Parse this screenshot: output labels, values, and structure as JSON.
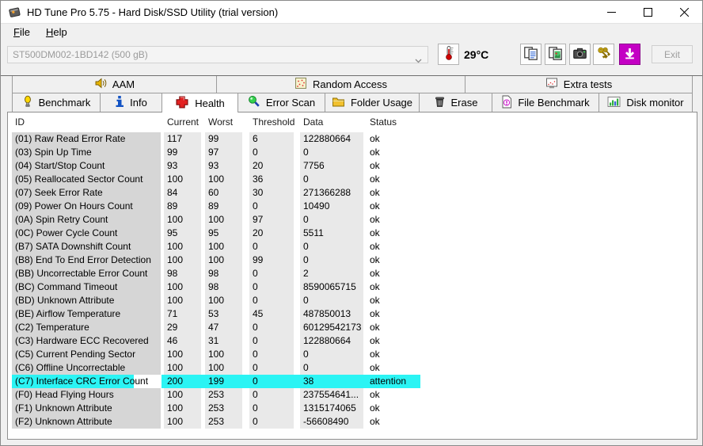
{
  "window": {
    "title": "HD Tune Pro 5.75 - Hard Disk/SSD Utility (trial version)"
  },
  "menu": {
    "items": [
      "File",
      "Help"
    ]
  },
  "toolbar": {
    "drive": "ST500DM002-1BD142 (500 gB)",
    "temperature": "29°C",
    "exit_label": "Exit"
  },
  "tabs_row1": [
    {
      "label": "AAM",
      "icon": "speaker-icon"
    },
    {
      "label": "Random Access",
      "icon": "random-access-icon"
    },
    {
      "label": "Extra tests",
      "icon": "extra-tests-icon"
    }
  ],
  "tabs_row2": [
    {
      "label": "Benchmark",
      "icon": "benchmark-icon",
      "active": false
    },
    {
      "label": "Info",
      "icon": "info-icon",
      "active": false
    },
    {
      "label": "Health",
      "icon": "health-cross-icon",
      "active": true
    },
    {
      "label": "Error Scan",
      "icon": "magnifier-icon",
      "active": false
    },
    {
      "label": "Folder Usage",
      "icon": "folder-icon",
      "active": false
    },
    {
      "label": "Erase",
      "icon": "trash-icon",
      "active": false
    },
    {
      "label": "File Benchmark",
      "icon": "file-benchmark-icon",
      "active": false
    },
    {
      "label": "Disk monitor",
      "icon": "disk-monitor-icon",
      "active": false
    }
  ],
  "icons": {
    "chevron-down": "v",
    "minimize": "—",
    "maximize": "▢",
    "close": "✕",
    "thermometer": "thermometer-red",
    "copy-text": "two-pages-text",
    "copy-image": "two-pages-image",
    "camera": "camera-screenshot",
    "keys": "registration-keys",
    "download": "magenta-down-arrow"
  },
  "colors": {
    "attention_highlight": "#2bf4f4",
    "download_button": "#c400c4",
    "id_column_bg": "#d6d6d6",
    "value_column_bg": "#e9e9e9",
    "health_cross": "#e32222"
  },
  "table": {
    "columns": [
      "ID",
      "Current",
      "Worst",
      "Threshold",
      "Data",
      "Status"
    ],
    "rows": [
      {
        "id": "(01) Raw Read Error Rate",
        "current": "117",
        "worst": "99",
        "threshold": "6",
        "data": "122880664",
        "status": "ok"
      },
      {
        "id": "(03) Spin Up Time",
        "current": "99",
        "worst": "97",
        "threshold": "0",
        "data": "0",
        "status": "ok"
      },
      {
        "id": "(04) Start/Stop Count",
        "current": "93",
        "worst": "93",
        "threshold": "20",
        "data": "7756",
        "status": "ok"
      },
      {
        "id": "(05) Reallocated Sector Count",
        "current": "100",
        "worst": "100",
        "threshold": "36",
        "data": "0",
        "status": "ok"
      },
      {
        "id": "(07) Seek Error Rate",
        "current": "84",
        "worst": "60",
        "threshold": "30",
        "data": "271366288",
        "status": "ok"
      },
      {
        "id": "(09) Power On Hours Count",
        "current": "89",
        "worst": "89",
        "threshold": "0",
        "data": "10490",
        "status": "ok"
      },
      {
        "id": "(0A) Spin Retry Count",
        "current": "100",
        "worst": "100",
        "threshold": "97",
        "data": "0",
        "status": "ok"
      },
      {
        "id": "(0C) Power Cycle Count",
        "current": "95",
        "worst": "95",
        "threshold": "20",
        "data": "5511",
        "status": "ok"
      },
      {
        "id": "(B7) SATA Downshift Count",
        "current": "100",
        "worst": "100",
        "threshold": "0",
        "data": "0",
        "status": "ok"
      },
      {
        "id": "(B8) End To End Error Detection",
        "current": "100",
        "worst": "100",
        "threshold": "99",
        "data": "0",
        "status": "ok"
      },
      {
        "id": "(BB) Uncorrectable Error Count",
        "current": "98",
        "worst": "98",
        "threshold": "0",
        "data": "2",
        "status": "ok"
      },
      {
        "id": "(BC) Command Timeout",
        "current": "100",
        "worst": "98",
        "threshold": "0",
        "data": "8590065715",
        "status": "ok"
      },
      {
        "id": "(BD) Unknown Attribute",
        "current": "100",
        "worst": "100",
        "threshold": "0",
        "data": "0",
        "status": "ok"
      },
      {
        "id": "(BE) Airflow Temperature",
        "current": "71",
        "worst": "53",
        "threshold": "45",
        "data": "487850013",
        "status": "ok"
      },
      {
        "id": "(C2) Temperature",
        "current": "29",
        "worst": "47",
        "threshold": "0",
        "data": "60129542173",
        "status": "ok"
      },
      {
        "id": "(C3) Hardware ECC Recovered",
        "current": "46",
        "worst": "31",
        "threshold": "0",
        "data": "122880664",
        "status": "ok"
      },
      {
        "id": "(C5) Current Pending Sector",
        "current": "100",
        "worst": "100",
        "threshold": "0",
        "data": "0",
        "status": "ok"
      },
      {
        "id": "(C6) Offline Uncorrectable",
        "current": "100",
        "worst": "100",
        "threshold": "0",
        "data": "0",
        "status": "ok"
      },
      {
        "id": "(C7) Interface CRC Error Count",
        "current": "200",
        "worst": "199",
        "threshold": "0",
        "data": "38",
        "status": "attention"
      },
      {
        "id": "(F0) Head Flying Hours",
        "current": "100",
        "worst": "253",
        "threshold": "0",
        "data": "237554641...",
        "status": "ok"
      },
      {
        "id": "(F1) Unknown Attribute",
        "current": "100",
        "worst": "253",
        "threshold": "0",
        "data": "1315174065",
        "status": "ok"
      },
      {
        "id": "(F2) Unknown Attribute",
        "current": "100",
        "worst": "253",
        "threshold": "0",
        "data": "-56608490",
        "status": "ok"
      }
    ]
  }
}
